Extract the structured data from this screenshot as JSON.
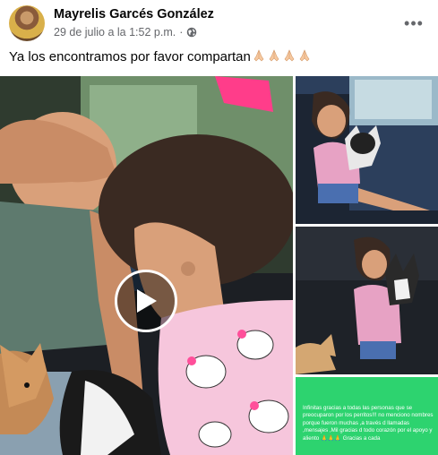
{
  "post": {
    "author": "Mayrelis Garcés González",
    "timestamp": "29 de julio a la 1:52 p.m.",
    "separator": "·",
    "privacy_icon": "globe-icon",
    "more_icon": "more-options-icon",
    "more_label": "•••",
    "caption": "Ya los encontramos por favor compartan",
    "caption_emoji": [
      "folded-hands-emoji",
      "folded-hands-emoji",
      "folded-hands-emoji",
      "folded-hands-emoji"
    ]
  },
  "media": {
    "main_video": {
      "kind": "video",
      "play_icon": "play-icon"
    },
    "side_photos": [
      {
        "kind": "photo"
      },
      {
        "kind": "photo"
      },
      {
        "kind": "photo",
        "background": "#2dd36f"
      }
    ],
    "thanks_text": "Infinitas gracias a todas las personas que se preocuparon por los perritos!!! no menciono nombres porque fueron muchas ,a través d llamadas ,mensajes ,Mil gracias d todo corazón por el apoyo y aliento 🙏🙏🙏 Gracias a cada"
  },
  "colors": {
    "text_primary": "#050505",
    "text_secondary": "#65676b",
    "thanks_background": "#2dd36f"
  }
}
